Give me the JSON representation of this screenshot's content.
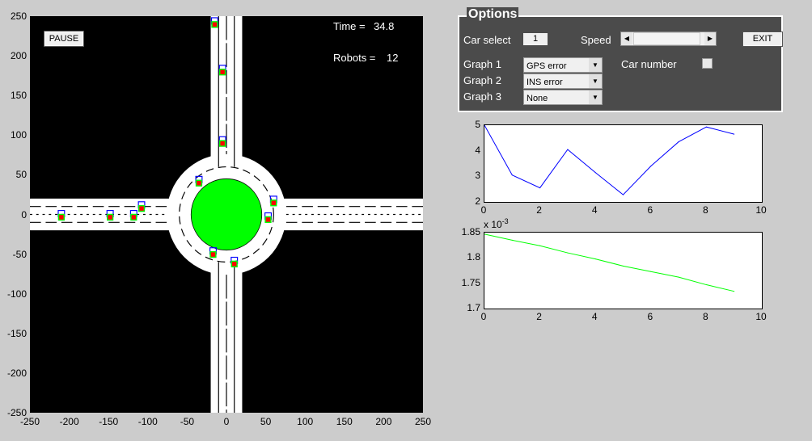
{
  "map": {
    "pause_label": "PAUSE",
    "time_label": "Time =",
    "time_value": "34.8",
    "robots_label": "Robots =",
    "robots_value": "12",
    "xlim": [
      -250,
      250
    ],
    "ylim": [
      -250,
      250
    ],
    "x_ticks": [
      "-250",
      "-200",
      "-150",
      "-100",
      "-50",
      "0",
      "50",
      "100",
      "150",
      "200",
      "250"
    ],
    "y_ticks": [
      "250",
      "200",
      "150",
      "100",
      "50",
      "0",
      "-50",
      "-100",
      "-150",
      "-200",
      "-250"
    ],
    "cars": [
      [
        -15,
        240
      ],
      [
        -5,
        180
      ],
      [
        -5,
        90
      ],
      [
        -35,
        40
      ],
      [
        -210,
        -3
      ],
      [
        -148,
        -3
      ],
      [
        -118,
        -3
      ],
      [
        -108,
        8
      ],
      [
        60,
        15
      ],
      [
        53,
        -6
      ],
      [
        -17,
        -50
      ],
      [
        10,
        -62
      ]
    ],
    "colors": {
      "island": "#00ff00",
      "car_body": "#ff0000",
      "car_outline": "#0000ff"
    }
  },
  "options": {
    "title": "Options",
    "car_select_label": "Car select",
    "car_select_value": "1",
    "speed_label": "Speed",
    "speed_fraction": 0.0,
    "exit_label": "EXIT",
    "graph1_label": "Graph 1",
    "graph1_value": "GPS error",
    "graph2_label": "Graph 2",
    "graph2_value": "INS error",
    "graph3_label": "Graph 3",
    "graph3_value": "None",
    "car_number_label": "Car number",
    "car_number_checked": false
  },
  "chart_data": [
    {
      "type": "line",
      "x": [
        0,
        1,
        2,
        3,
        4,
        5,
        6,
        7,
        8,
        9
      ],
      "values": [
        5,
        3.05,
        2.55,
        4.05,
        3.15,
        2.28,
        3.4,
        4.35,
        4.93,
        4.65
      ],
      "xlim": [
        0,
        10
      ],
      "ylim": [
        2,
        5
      ],
      "x_ticks": [
        "0",
        "2",
        "4",
        "6",
        "8",
        "10"
      ],
      "y_ticks": [
        "5",
        "4",
        "3",
        "2"
      ],
      "color": "#0000ff"
    },
    {
      "type": "line",
      "x": [
        0,
        1,
        2,
        3,
        4,
        5,
        6,
        7,
        8,
        9
      ],
      "values": [
        1.847,
        1.835,
        1.824,
        1.81,
        1.798,
        1.784,
        1.773,
        1.762,
        1.747,
        1.734
      ],
      "xlim": [
        0,
        10
      ],
      "ylim": [
        1.7,
        1.85
      ],
      "x_ticks": [
        "0",
        "2",
        "4",
        "6",
        "8",
        "10"
      ],
      "y_ticks": [
        "1.85",
        "1.8",
        "1.75",
        "1.7"
      ],
      "exponent_label": "x 10",
      "exponent": "-3",
      "color": "#00ff00"
    }
  ]
}
